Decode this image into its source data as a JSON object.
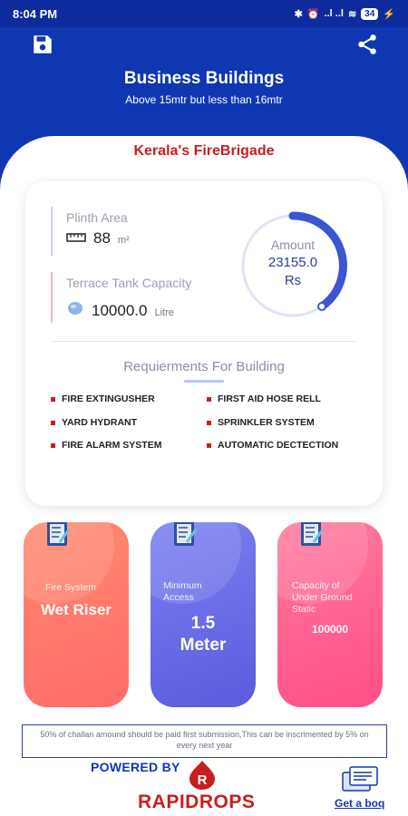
{
  "status_bar": {
    "time": "8:04 PM",
    "signal_text": "..l ..l",
    "battery": "34"
  },
  "header": {
    "title": "Business Buildings",
    "subtitle": "Above 15mtr but less than 16mtr"
  },
  "org_name": "Kerala's FireBrigade",
  "summary": {
    "plinth_label": "Plinth Area",
    "plinth_value": "88",
    "plinth_unit": "m²",
    "tank_label": "Terrace Tank Capacity",
    "tank_value": "10000.0",
    "tank_unit": "Litre",
    "amount_label": "Amount",
    "amount_value": "23155.0",
    "amount_unit": "Rs"
  },
  "requirements": {
    "title": "Requierments For Building",
    "items": [
      "FIRE EXTINGUSHER",
      "FIRST AID HOSE RELL",
      "YARD HYDRANT",
      "SPRINKLER SYSTEM",
      "FIRE ALARM SYSTEM",
      "AUTOMATIC DECTECTION"
    ]
  },
  "tiles": [
    {
      "label": "Fire System",
      "value": "Wet Riser"
    },
    {
      "label": "Minimum Access",
      "value": "1.5 Meter"
    },
    {
      "label": "Capacity of Under Ground Static",
      "value": "100000"
    }
  ],
  "notice": "50% of challan amound should be paid first submission,This can be inscrimented by 5% on every next year",
  "footer": {
    "powered_by": "POWERED BY",
    "brand": "RAPIDROPS",
    "logo_letter": "R",
    "boq_link": "Get a boq"
  },
  "colors": {
    "header_blue": "#1037b2",
    "brand_red": "#c61e20"
  },
  "icons": [
    "save-icon",
    "share-icon",
    "ruler-icon",
    "water-drop-icon",
    "checklist-icon",
    "document-icon"
  ]
}
